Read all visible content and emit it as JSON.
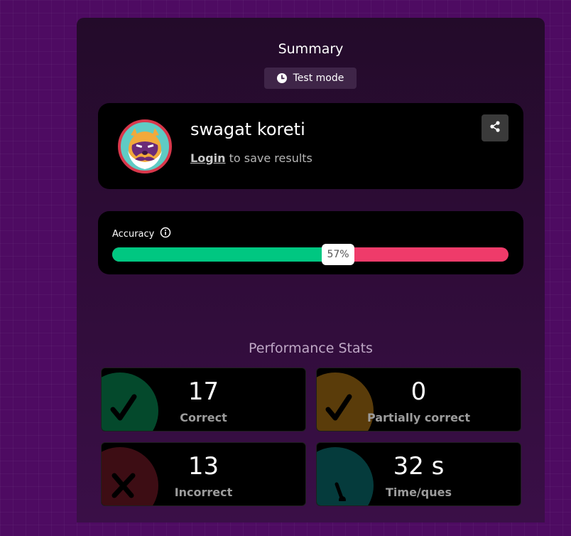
{
  "summary": {
    "title": "Summary",
    "mode_label": "Test mode"
  },
  "user": {
    "name": "swagat koreti",
    "login_link": "Login",
    "login_suffix": " to save results"
  },
  "accuracy": {
    "label": "Accuracy",
    "percent_value": 57,
    "percent_label": "57%",
    "correct_color": "#00c781",
    "incorrect_color": "#ef3b6a"
  },
  "performance": {
    "title": "Performance Stats",
    "stats": [
      {
        "value": "17",
        "label": "Correct",
        "icon": "check-icon"
      },
      {
        "value": "0",
        "label": "Partially correct",
        "icon": "check-icon"
      },
      {
        "value": "13",
        "label": "Incorrect",
        "icon": "cross-icon"
      },
      {
        "value": "32 s",
        "label": "Time/ques",
        "icon": "stopwatch-icon"
      }
    ]
  },
  "colors": {
    "background": "#4e0b62",
    "panel": "#2e0c37",
    "card": "#000000"
  }
}
